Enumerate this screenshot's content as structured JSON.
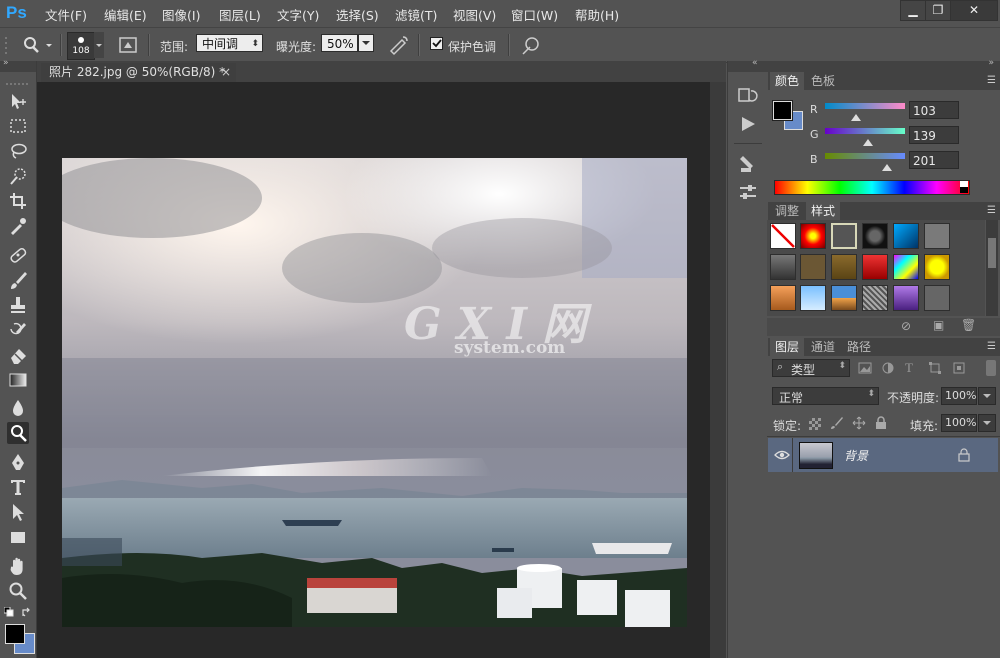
{
  "app": {
    "logo": "Ps"
  },
  "menu": [
    "文件(F)",
    "编辑(E)",
    "图像(I)",
    "图层(L)",
    "文字(Y)",
    "选择(S)",
    "滤镜(T)",
    "视图(V)",
    "窗口(W)",
    "帮助(H)"
  ],
  "window_controls": {
    "minimize": "▁",
    "restore": "❐",
    "close": "✕"
  },
  "options": {
    "brush_size": "108",
    "range_label": "范围:",
    "range_value": "中间调",
    "exposure_label": "曝光度:",
    "exposure_value": "50%",
    "protect_tones_label": "保护色调",
    "protect_tones_checked": true
  },
  "document": {
    "tab_title": "照片 282.jpg @ 50%(RGB/8) *",
    "close": "×",
    "watermark_main": "G X I 网",
    "watermark_sub": "system.com"
  },
  "color_panel": {
    "tabs": [
      "颜色",
      "色板"
    ],
    "active_tab": "颜色",
    "r_label": "R",
    "g_label": "G",
    "b_label": "B",
    "r": "103",
    "g": "139",
    "b": "201",
    "foreground": "#000000",
    "background": "#678bc9"
  },
  "styles_panel": {
    "tabs": [
      "调整",
      "样式"
    ],
    "active_tab": "样式"
  },
  "layers_panel": {
    "tabs": [
      "图层",
      "通道",
      "路径"
    ],
    "active_tab": "图层",
    "filter_kind": "类型",
    "blend_mode": "正常",
    "opacity_label": "不透明度:",
    "opacity_value": "100%",
    "lock_label": "锁定:",
    "fill_label": "填充:",
    "fill_value": "100%",
    "layers": [
      {
        "name": "背景",
        "visible": true,
        "locked": true
      }
    ]
  }
}
